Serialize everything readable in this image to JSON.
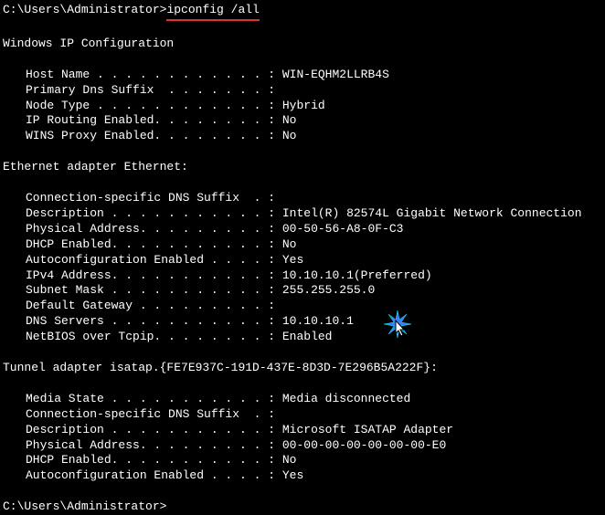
{
  "prompt1": {
    "path": "C:\\Users\\Administrator>",
    "command": "ipconfig /all"
  },
  "header": "Windows IP Configuration",
  "host": {
    "hostname_label": "Host Name . . . . . . . . . . . . : ",
    "hostname_value": "WIN-EQHM2LLRB4S",
    "primary_dns_label": "Primary Dns Suffix  . . . . . . . :",
    "primary_dns_value": "",
    "node_type_label": "Node Type . . . . . . . . . . . . : ",
    "node_type_value": "Hybrid",
    "ip_routing_label": "IP Routing Enabled. . . . . . . . : ",
    "ip_routing_value": "No",
    "wins_proxy_label": "WINS Proxy Enabled. . . . . . . . : ",
    "wins_proxy_value": "No"
  },
  "eth_header": "Ethernet adapter Ethernet:",
  "eth": {
    "conn_suffix_label": "Connection-specific DNS Suffix  . :",
    "conn_suffix_value": "",
    "desc_label": "Description . . . . . . . . . . . : ",
    "desc_value": "Intel(R) 82574L Gigabit Network Connection",
    "phys_label": "Physical Address. . . . . . . . . : ",
    "phys_value": "00-50-56-A8-0F-C3",
    "dhcp_label": "DHCP Enabled. . . . . . . . . . . : ",
    "dhcp_value": "No",
    "autoconf_label": "Autoconfiguration Enabled . . . . : ",
    "autoconf_value": "Yes",
    "ipv4_label": "IPv4 Address. . . . . . . . . . . : ",
    "ipv4_value": "10.10.10.1(Preferred)",
    "subnet_label": "Subnet Mask . . . . . . . . . . . : ",
    "subnet_value": "255.255.255.0",
    "gateway_label": "Default Gateway . . . . . . . . . :",
    "gateway_value": "",
    "dns_label": "DNS Servers . . . . . . . . . . . : ",
    "dns_value": "10.10.10.1",
    "netbios_label": "NetBIOS over Tcpip. . . . . . . . : ",
    "netbios_value": "Enabled"
  },
  "tunnel_header": "Tunnel adapter isatap.{FE7E937C-191D-437E-8D3D-7E296B5A222F}:",
  "tunnel": {
    "media_label": "Media State . . . . . . . . . . . : ",
    "media_value": "Media disconnected",
    "conn_suffix_label": "Connection-specific DNS Suffix  . :",
    "conn_suffix_value": "",
    "desc_label": "Description . . . . . . . . . . . : ",
    "desc_value": "Microsoft ISATAP Adapter",
    "phys_label": "Physical Address. . . . . . . . . : ",
    "phys_value": "00-00-00-00-00-00-00-E0",
    "dhcp_label": "DHCP Enabled. . . . . . . . . . . : ",
    "dhcp_value": "No",
    "autoconf_label": "Autoconfiguration Enabled . . . . : ",
    "autoconf_value": "Yes"
  },
  "prompt2": "C:\\Users\\Administrator>"
}
